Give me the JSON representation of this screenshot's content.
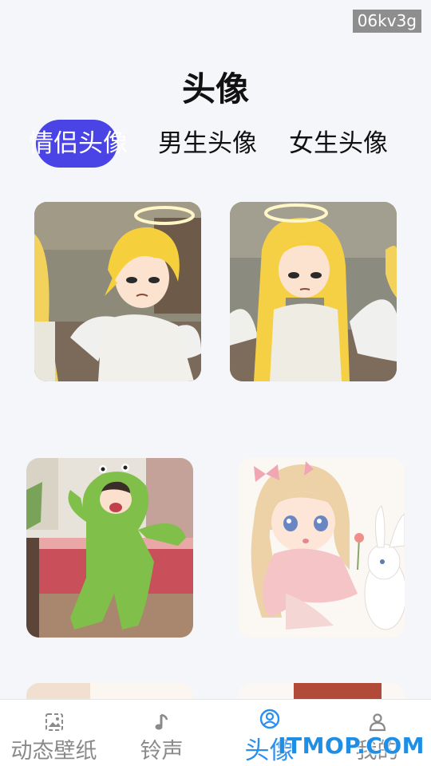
{
  "watermark_top": "06kv3g",
  "page": {
    "title": "头像"
  },
  "tabs": [
    {
      "label": "情侣头像",
      "active": true
    },
    {
      "label": "男生头像",
      "active": false
    },
    {
      "label": "女生头像",
      "active": false
    }
  ],
  "cards": [
    {
      "subject": "angel-boy-blonde"
    },
    {
      "subject": "angel-girl-blonde"
    },
    {
      "subject": "boy-green-dino-costume"
    },
    {
      "subject": "girl-with-bunny"
    },
    {
      "subject": "partial"
    },
    {
      "subject": "partial"
    }
  ],
  "bottom_nav": [
    {
      "label": "动态壁纸",
      "icon": "wallpaper-icon",
      "active": false
    },
    {
      "label": "铃声",
      "icon": "music-note-icon",
      "active": false
    },
    {
      "label": "头像",
      "icon": "avatar-icon",
      "active": true
    },
    {
      "label": "我的",
      "icon": "person-icon",
      "active": false
    }
  ],
  "watermark_bottom": "ITMOP.COM",
  "colors": {
    "accent": "#4a43e6",
    "nav_active": "#2a8ff0",
    "background": "#f4f6f9"
  }
}
